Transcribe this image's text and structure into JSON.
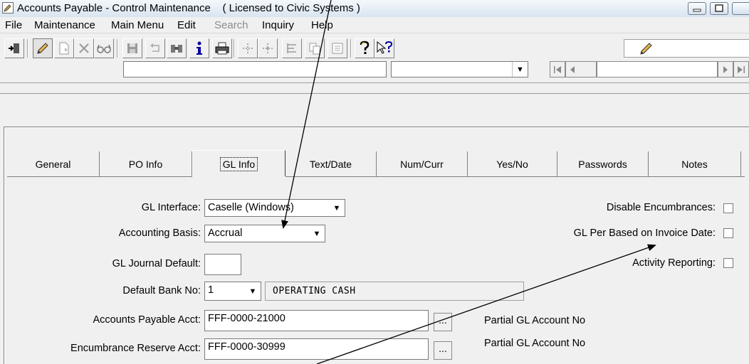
{
  "window": {
    "title": "Accounts Payable - Control Maintenance    ( Licensed to Civic Systems )"
  },
  "menu": {
    "items": [
      {
        "label": "File",
        "disabled": false
      },
      {
        "label": "Maintenance",
        "disabled": false
      },
      {
        "label": "Main Menu",
        "disabled": false
      },
      {
        "label": "Edit",
        "disabled": false
      },
      {
        "label": "Search",
        "disabled": true
      },
      {
        "label": "Inquiry",
        "disabled": false
      },
      {
        "label": "Help",
        "disabled": false
      }
    ]
  },
  "toolbar": {
    "icons": [
      "exit-icon",
      "edit-pencil-icon",
      "new-record-icon",
      "delete-icon",
      "view-glasses-icon",
      "save-icon",
      "undo-icon",
      "find-binoculars-icon",
      "info-icon",
      "print-icon",
      "move-icon",
      "move-all-icon",
      "list-icon",
      "copy-icon",
      "report-icon",
      "help-icon",
      "context-help-icon"
    ]
  },
  "tabs": [
    {
      "label": "General"
    },
    {
      "label": "PO Info"
    },
    {
      "label": "GL Info"
    },
    {
      "label": "Text/Date"
    },
    {
      "label": "Num/Curr"
    },
    {
      "label": "Yes/No"
    },
    {
      "label": "Passwords"
    },
    {
      "label": "Notes"
    }
  ],
  "form": {
    "gl_interface": {
      "label": "GL Interface:",
      "value": "Caselle (Windows)"
    },
    "accounting_basis": {
      "label": "Accounting Basis:",
      "value": "Accrual"
    },
    "gl_journal_default": {
      "label": "GL Journal Default:",
      "value": ""
    },
    "default_bank_no": {
      "label": "Default Bank No:",
      "value": "1",
      "description": "OPERATING CASH"
    },
    "accounts_payable_acct": {
      "label": "Accounts Payable Acct:",
      "value": "FFF-0000-21000",
      "hint": "Partial GL Account No"
    },
    "encumbrance_reserve_acct": {
      "label": "Encumbrance Reserve Acct:",
      "value": "FFF-0000-30999",
      "hint": "Partial GL Account No"
    },
    "disable_encumbrances": {
      "label": "Disable Encumbrances:",
      "checked": false
    },
    "gl_per_invoice_date": {
      "label": "GL Per Based on Invoice Date:",
      "checked": false
    },
    "activity_reporting": {
      "label": "Activity Reporting:",
      "checked": false
    }
  }
}
